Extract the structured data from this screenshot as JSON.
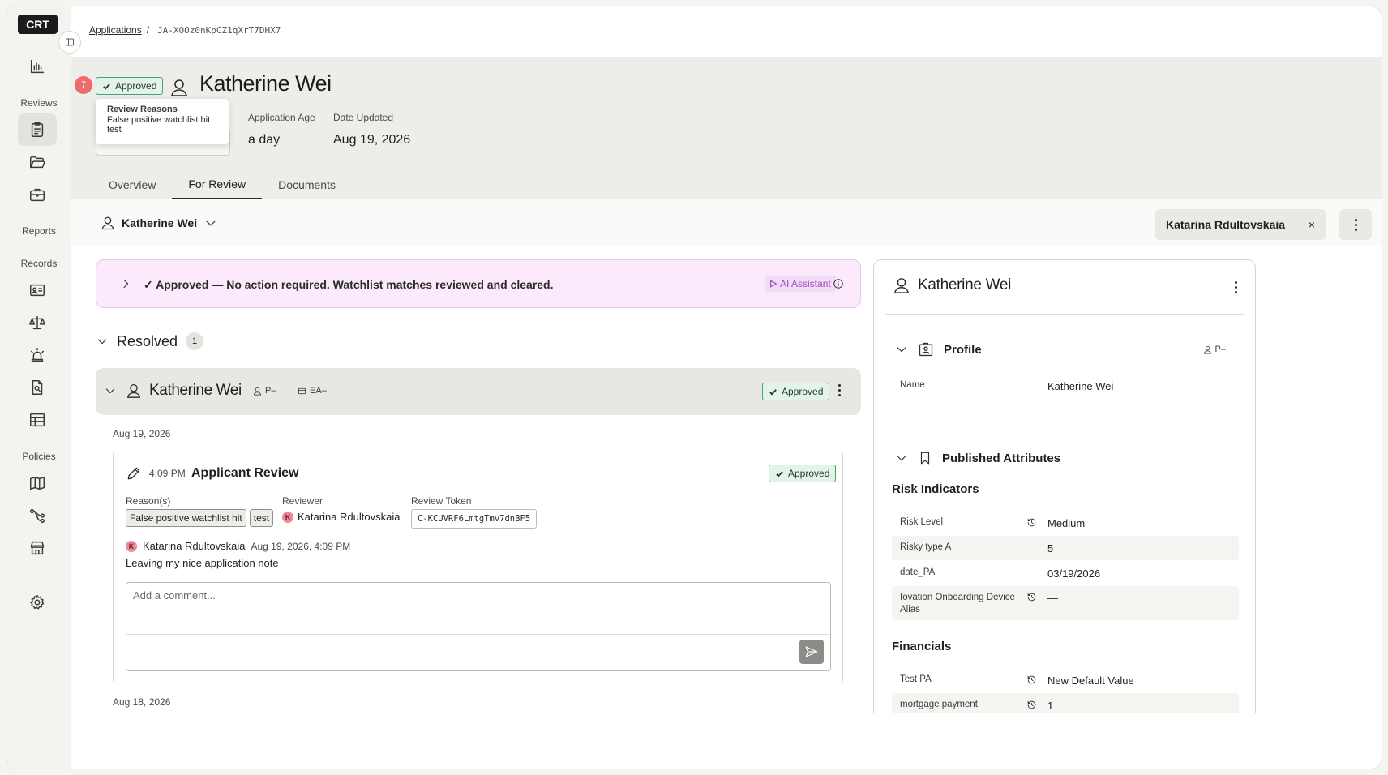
{
  "app": {
    "logo": "CRT"
  },
  "breadcrumb": {
    "parent": "Applications",
    "separator": "/",
    "current": "JA-XOOz0nKpCZ1qXrT7DHX7"
  },
  "sidebar": {
    "sections": {
      "reviews": "Reviews",
      "reports": "Reports",
      "records": "Records",
      "policies": "Policies"
    },
    "icons": [
      "dashboard-chart-icon",
      "clipboard-icon",
      "folder-icon",
      "briefcase-icon",
      "id-card-icon",
      "scales-icon",
      "siren-icon",
      "document-search-icon",
      "table-icon",
      "map-icon",
      "workflow-icon",
      "store-icon",
      "gear-icon"
    ]
  },
  "header": {
    "notification_count": "7",
    "status": "Approved",
    "name": "Katherine Wei",
    "tooltip": {
      "title": "Review Reasons",
      "lines": [
        "False positive watchlist hit",
        "test"
      ]
    },
    "meta": [
      {
        "label": "Application Age",
        "value": "a day"
      },
      {
        "label": "Date Updated",
        "value": "Aug 19, 2026"
      }
    ],
    "tabs": [
      "Overview",
      "For Review",
      "Documents"
    ],
    "active_tab": "For Review"
  },
  "subbar": {
    "person": "Katherine Wei",
    "assignee": "Katarina Rdultovskaia",
    "remove": "×"
  },
  "ai_banner": {
    "text": "✓ Approved — No action required. Watchlist matches reviewed and cleared.",
    "badge": "AI Assistant"
  },
  "resolved": {
    "title": "Resolved",
    "count": "1",
    "row": {
      "name": "Katherine Wei",
      "person_tag": "P–",
      "entity_tag": "EA–",
      "status": "Approved"
    },
    "dates": [
      "Aug 19, 2026",
      "Aug 18, 2026"
    ],
    "review": {
      "time": "4:09 PM",
      "title": "Applicant Review",
      "status": "Approved",
      "labels": {
        "reasons": "Reason(s)",
        "reviewer": "Reviewer",
        "token": "Review Token"
      },
      "reasons": [
        "False positive watchlist hit",
        "test"
      ],
      "reviewer_initial": "K",
      "reviewer": "Katarina Rdultovskaia",
      "token": "C-KCUVRF6LmtgTmv7dnBF5",
      "comment": {
        "initial": "K",
        "author": "Katarina Rdultovskaia",
        "when": "Aug 19, 2026, 4:09 PM",
        "text": "Leaving my nice application note"
      },
      "comment_placeholder": "Add a comment..."
    }
  },
  "panel": {
    "name": "Katherine Wei",
    "profile": {
      "title": "Profile",
      "tag": "P–",
      "name_label": "Name",
      "name_value": "Katherine Wei"
    },
    "attributes": {
      "title": "Published Attributes",
      "risk_title": "Risk Indicators",
      "risk": [
        {
          "key": "Risk Level",
          "value": "Medium",
          "history": true
        },
        {
          "key": "Risky type A",
          "value": "5",
          "history": false
        },
        {
          "key": "date_PA",
          "value": "03/19/2026",
          "history": false
        },
        {
          "key": "Iovation Onboarding Device Alias",
          "value": "—",
          "history": true
        }
      ],
      "fin_title": "Financials",
      "financials": [
        {
          "key": "Test PA",
          "value": "New Default Value",
          "history": true
        },
        {
          "key": "mortgage payment",
          "value": "1",
          "history": true
        }
      ]
    }
  },
  "colors": {
    "approved_bg": "#e4f3ea",
    "approved_border": "#46a36b",
    "badge_red": "#ee6b6b",
    "ai_pink": "#fbeafb",
    "ai_purple": "#a348c7"
  }
}
